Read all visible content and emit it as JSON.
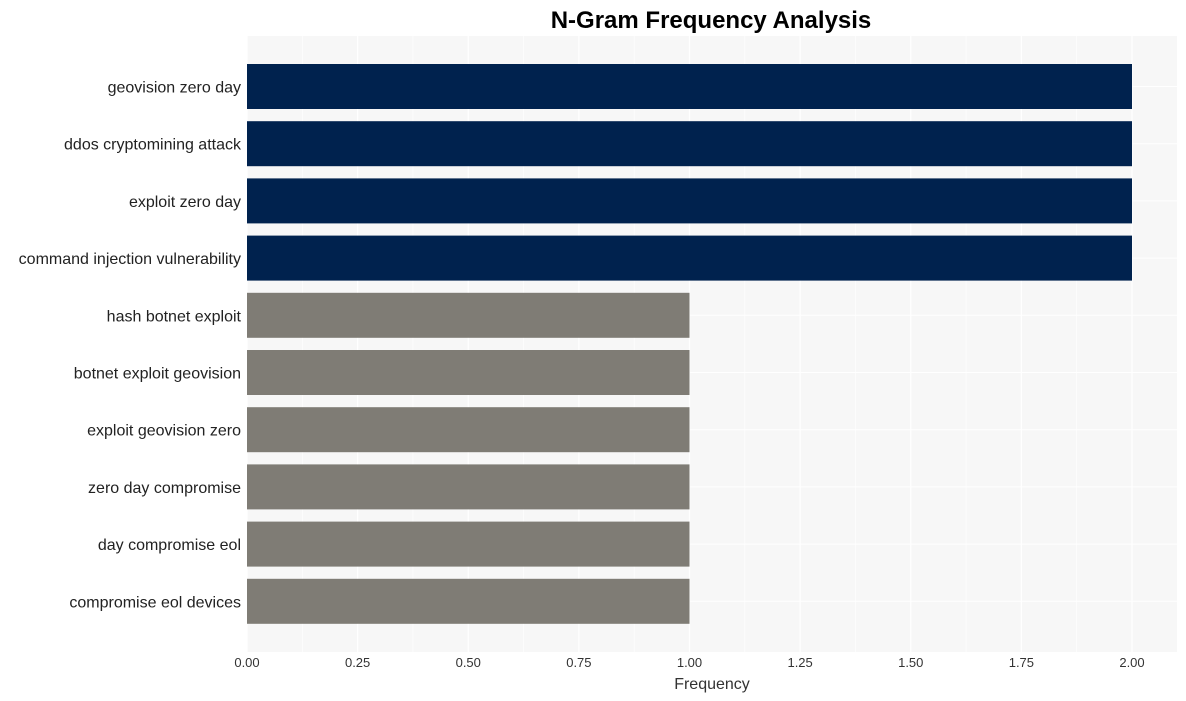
{
  "chart_data": {
    "type": "bar",
    "orientation": "horizontal",
    "title": "N-Gram Frequency Analysis",
    "xlabel": "Frequency",
    "ylabel": "",
    "xlim": [
      0,
      2.1
    ],
    "xticks": [
      "0.00",
      "0.25",
      "0.50",
      "0.75",
      "1.00",
      "1.25",
      "1.50",
      "1.75",
      "2.00"
    ],
    "xtick_values": [
      0,
      0.25,
      0.5,
      0.75,
      1.0,
      1.25,
      1.5,
      1.75,
      2.0
    ],
    "grid": true,
    "categories": [
      "geovision zero day",
      "ddos cryptomining attack",
      "exploit zero day",
      "command injection vulnerability",
      "hash botnet exploit",
      "botnet exploit geovision",
      "exploit geovision zero",
      "zero day compromise",
      "day compromise eol",
      "compromise eol devices"
    ],
    "values": [
      2,
      2,
      2,
      2,
      1,
      1,
      1,
      1,
      1,
      1
    ],
    "colors": {
      "high": "#00224e",
      "low": "#7f7c75",
      "plot_background": "#f7f7f7",
      "grid": "#ffffff"
    }
  }
}
